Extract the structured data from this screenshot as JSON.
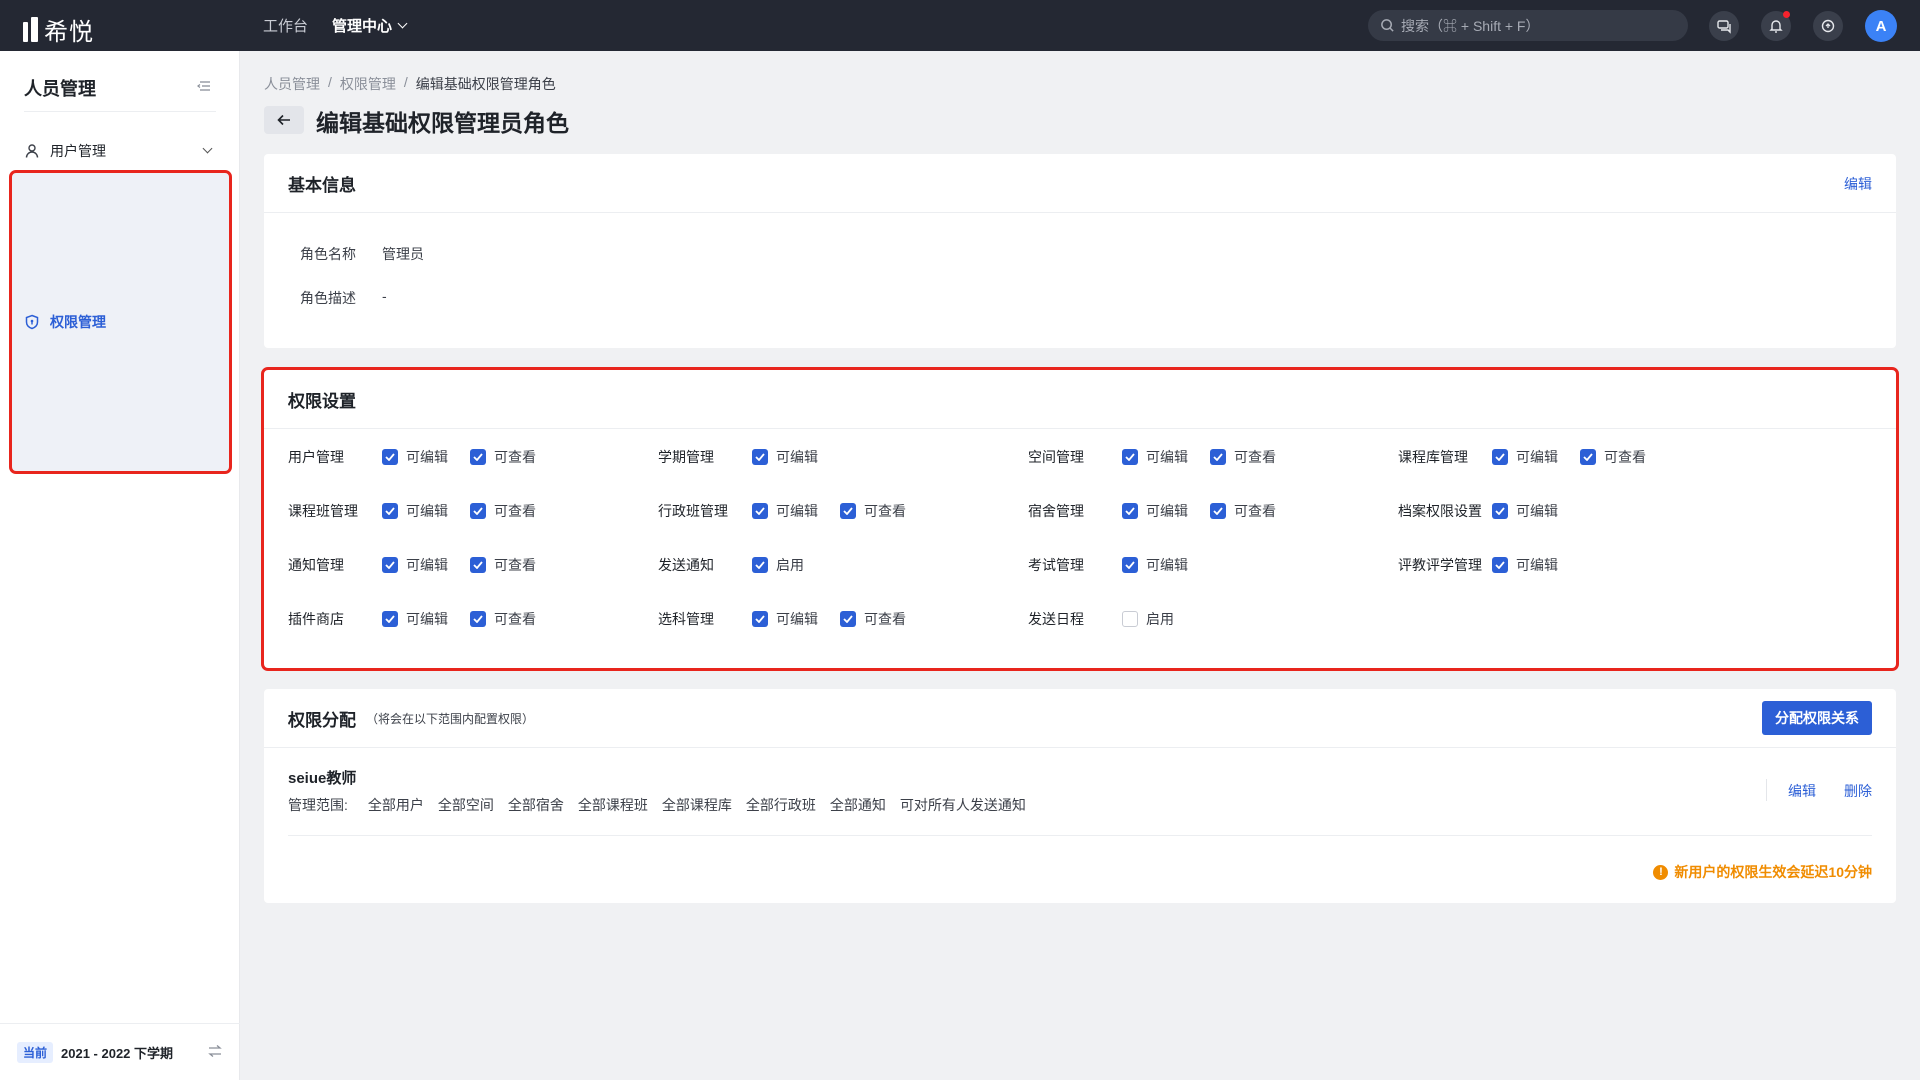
{
  "app": {
    "logo_text": "希悦"
  },
  "nav": {
    "workbench": "工作台",
    "admin_center": "管理中心"
  },
  "search": {
    "placeholder": "搜索（⌘ + Shift + F）"
  },
  "user": {
    "avatar_letter": "A"
  },
  "sidebar": {
    "title": "人员管理",
    "items": [
      {
        "label": "用户管理",
        "icon": "user-icon"
      },
      {
        "label": "权限管理",
        "icon": "shield-icon"
      }
    ],
    "current_badge": "当前",
    "semester": "2021 - 2022 下学期"
  },
  "breadcrumb": {
    "items": [
      "人员管理",
      "权限管理",
      "编辑基础权限管理角色"
    ]
  },
  "page": {
    "title": "编辑基础权限管理员角色"
  },
  "basic_info": {
    "title": "基本信息",
    "edit_label": "编辑",
    "fields": [
      {
        "key": "角色名称",
        "value": "管理员"
      },
      {
        "key": "角色描述",
        "value": "-"
      }
    ]
  },
  "permissions": {
    "title": "权限设置",
    "items": [
      {
        "name": "用户管理",
        "options": [
          {
            "label": "可编辑",
            "checked": true
          },
          {
            "label": "可查看",
            "checked": true
          }
        ]
      },
      {
        "name": "学期管理",
        "options": [
          {
            "label": "可编辑",
            "checked": true
          }
        ]
      },
      {
        "name": "空间管理",
        "options": [
          {
            "label": "可编辑",
            "checked": true
          },
          {
            "label": "可查看",
            "checked": true
          }
        ]
      },
      {
        "name": "课程库管理",
        "options": [
          {
            "label": "可编辑",
            "checked": true
          },
          {
            "label": "可查看",
            "checked": true
          }
        ]
      },
      {
        "name": "课程班管理",
        "options": [
          {
            "label": "可编辑",
            "checked": true
          },
          {
            "label": "可查看",
            "checked": true
          }
        ]
      },
      {
        "name": "行政班管理",
        "options": [
          {
            "label": "可编辑",
            "checked": true
          },
          {
            "label": "可查看",
            "checked": true
          }
        ]
      },
      {
        "name": "宿舍管理",
        "options": [
          {
            "label": "可编辑",
            "checked": true
          },
          {
            "label": "可查看",
            "checked": true
          }
        ]
      },
      {
        "name": "档案权限设置",
        "options": [
          {
            "label": "可编辑",
            "checked": true
          }
        ]
      },
      {
        "name": "通知管理",
        "options": [
          {
            "label": "可编辑",
            "checked": true
          },
          {
            "label": "可查看",
            "checked": true
          }
        ]
      },
      {
        "name": "发送通知",
        "options": [
          {
            "label": "启用",
            "checked": true
          }
        ]
      },
      {
        "name": "考试管理",
        "options": [
          {
            "label": "可编辑",
            "checked": true
          }
        ]
      },
      {
        "name": "评教评学管理",
        "options": [
          {
            "label": "可编辑",
            "checked": true
          }
        ]
      },
      {
        "name": "插件商店",
        "options": [
          {
            "label": "可编辑",
            "checked": true
          },
          {
            "label": "可查看",
            "checked": true
          }
        ]
      },
      {
        "name": "选科管理",
        "options": [
          {
            "label": "可编辑",
            "checked": true
          },
          {
            "label": "可查看",
            "checked": true
          }
        ]
      },
      {
        "name": "发送日程",
        "options": [
          {
            "label": "启用",
            "checked": false
          }
        ]
      }
    ]
  },
  "assignment": {
    "title": "权限分配",
    "subtitle": "（将会在以下范围内配置权限）",
    "button_label": "分配权限关系",
    "role_name": "seiue教师",
    "scope_label": "管理范围:",
    "scopes": [
      "全部用户",
      "全部空间",
      "全部宿舍",
      "全部课程班",
      "全部课程库",
      "全部行政班",
      "全部通知",
      "可对所有人发送通知"
    ],
    "edit_label": "编辑",
    "delete_label": "删除",
    "notice": "新用户的权限生效会延迟10分钟"
  },
  "colors": {
    "accent": "#2c5fd6",
    "topbar": "#242833",
    "highlight_border": "#e8251d",
    "warning": "#f08c00"
  }
}
